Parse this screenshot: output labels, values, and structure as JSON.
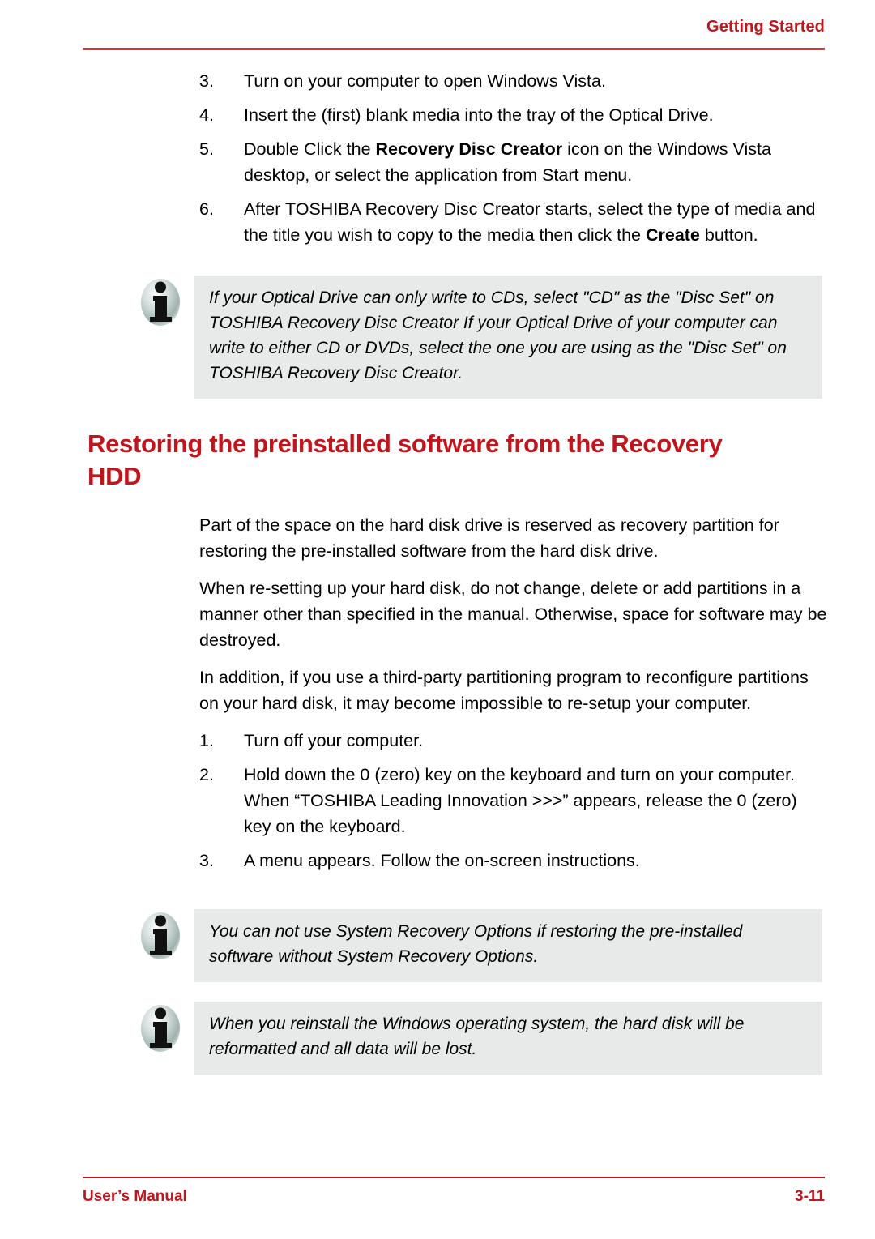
{
  "header": {
    "title": "Getting Started",
    "rule_color": "#D23B3B"
  },
  "colors": {
    "accent_red": "#C2141B",
    "note_background": "#E7EAE9",
    "text": "#000000"
  },
  "list_top": {
    "items": [
      {
        "number": "3.",
        "text_before": "Turn on your computer to open Windows Vista.",
        "bold": "",
        "text_after": ""
      },
      {
        "number": "4.",
        "text_before": "Insert the (first) blank media into the tray of the Optical Drive.",
        "bold": "",
        "text_after": ""
      },
      {
        "number": "5.",
        "text_before": "Double Click the ",
        "bold": "Recovery Disc Creator",
        "text_after": " icon on the Windows Vista desktop, or select the application from Start menu."
      },
      {
        "number": "6.",
        "text_before": "After TOSHIBA Recovery Disc Creator starts, select the type of media and the title  you wish to copy to the media then click the ",
        "bold": "Create",
        "text_after": " button."
      }
    ]
  },
  "note_1": {
    "icon": "info-icon",
    "text": "If your Optical Drive can only write to CDs, select \"CD\" as the \"Disc Set\" on TOSHIBA Recovery Disc Creator If your Optical Drive of your computer can write to either CD or DVDs, select the one you are using as the \"Disc Set\" on TOSHIBA Recovery Disc Creator."
  },
  "section": {
    "heading": "Restoring the preinstalled software from the Recovery HDD"
  },
  "paragraphs": [
    "Part of the space on the hard disk drive is reserved as recovery partition for restoring the pre-installed software from the hard disk drive.",
    "When re-setting up your hard disk, do not change, delete or add partitions in a manner other than specified in the manual. Otherwise, space for software may be destroyed.",
    "In addition, if you use a third-party partitioning program to reconfigure partitions on your hard disk, it may become impossible to re-setup your computer."
  ],
  "list_bottom": {
    "items": [
      {
        "number": "1.",
        "text_before": "Turn off your computer.",
        "bold": "",
        "text_after": ""
      },
      {
        "number": "2.",
        "text_before": "Hold down the 0 (zero) key on the keyboard and turn on your computer. When “TOSHIBA Leading Innovation >>>” appears, release the 0 (zero) key on the keyboard.",
        "bold": "",
        "text_after": ""
      },
      {
        "number": "3.",
        "text_before": "A menu appears. Follow the on-screen instructions.",
        "bold": "",
        "text_after": ""
      }
    ]
  },
  "note_2": {
    "icon": "info-icon",
    "text": "You can not use System Recovery Options if restoring the pre-installed software without System Recovery Options."
  },
  "note_3": {
    "icon": "info-icon",
    "text": "When you reinstall the Windows operating system, the hard disk will be reformatted and all data will be lost."
  },
  "footer": {
    "left": "User’s Manual",
    "right": "3-11"
  }
}
